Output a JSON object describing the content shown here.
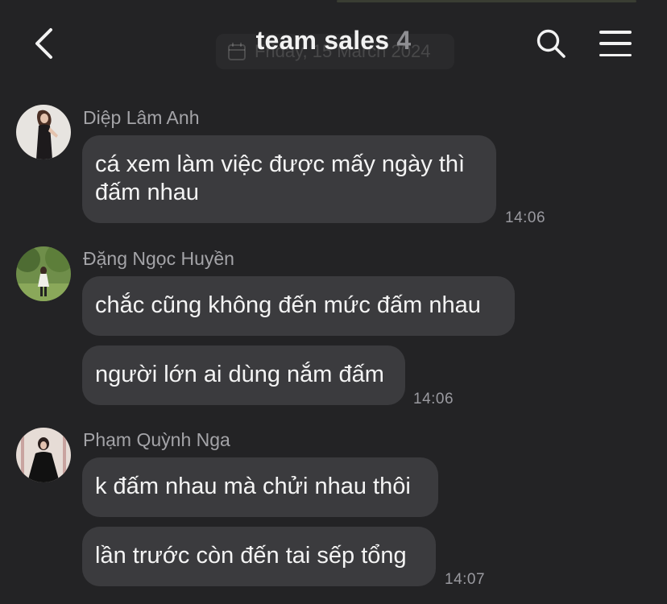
{
  "header": {
    "title": "team sales",
    "member_count": "4",
    "date_chip": "Friday, 15 March 2024",
    "icons": {
      "back": "chevron-left-icon",
      "calendar": "calendar-icon",
      "search": "search-icon",
      "menu": "menu-icon"
    }
  },
  "colors": {
    "background": "#232325",
    "bubble": "#3b3b3e",
    "sender_name": "#a4a4a8",
    "timestamp": "#9a9aa0"
  },
  "messages": [
    {
      "sender": "Diệp Lâm Anh",
      "avatar": "avatar-photo",
      "bubbles": [
        {
          "lines": [
            "cá xem làm việc được mấy ngày thì",
            "đấm nhau"
          ]
        }
      ],
      "time": "14:06"
    },
    {
      "sender": "Đặng Ngọc Huyền",
      "avatar": "avatar-photo",
      "bubbles": [
        {
          "lines": [
            "chắc cũng không đến mức đấm nhau"
          ]
        },
        {
          "lines": [
            "người lớn ai dùng nắm đấm"
          ]
        }
      ],
      "time": "14:06"
    },
    {
      "sender": "Phạm Quỳnh Nga",
      "avatar": "avatar-photo",
      "bubbles": [
        {
          "lines": [
            "k đấm nhau mà chửi nhau thôi"
          ]
        },
        {
          "lines": [
            "lần trước còn đến tai sếp tổng"
          ]
        }
      ],
      "time": "14:07"
    }
  ]
}
